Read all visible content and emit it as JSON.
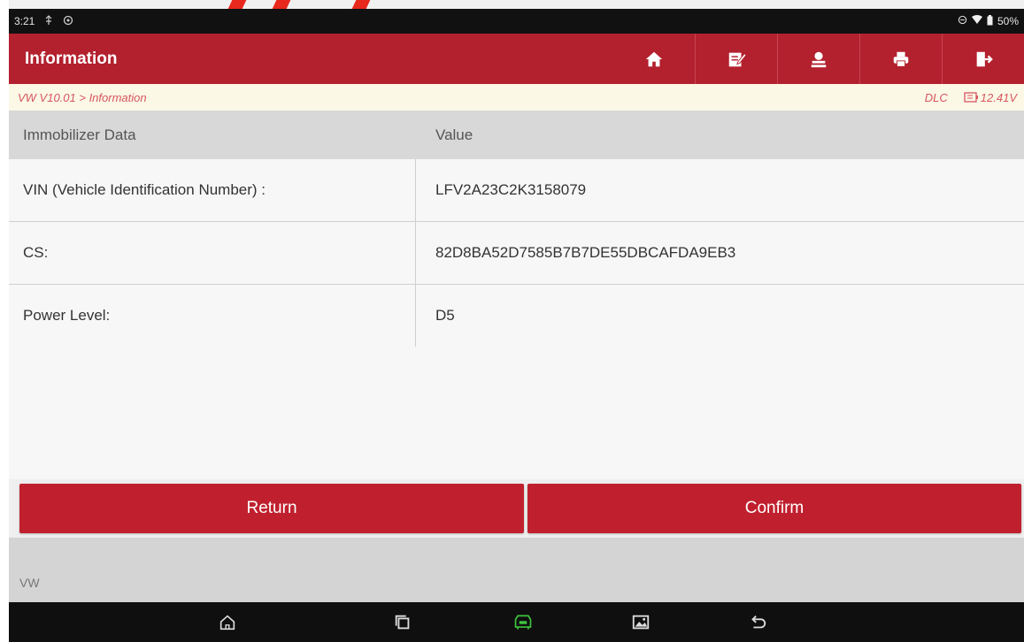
{
  "status": {
    "time": "3:21",
    "battery": "50%"
  },
  "header": {
    "title": "Information"
  },
  "toolbar": {
    "icons": [
      "home-icon",
      "edit-icon",
      "user-icon",
      "print-icon",
      "exit-icon"
    ]
  },
  "breadcrumb": {
    "path": "VW V10.01 > Information",
    "connector": "DLC",
    "voltage": "12.41V"
  },
  "table": {
    "headers": [
      "Immobilizer Data",
      "Value"
    ],
    "rows": [
      {
        "label": "VIN (Vehicle Identification Number) :",
        "value": "LFV2A23C2K3158079"
      },
      {
        "label": "CS:",
        "value": "82D8BA52D7585B7B7DE55DBCAFDA9EB3"
      },
      {
        "label": "Power Level:",
        "value": "D5"
      }
    ]
  },
  "actions": {
    "return_label": "Return",
    "confirm_label": "Confirm"
  },
  "footer": {
    "brand": "VW"
  },
  "colors": {
    "primary": "#b3202e",
    "button": "#c0202e",
    "breadcrumb_text": "#d8555f",
    "vci_green": "#3ec43e"
  }
}
